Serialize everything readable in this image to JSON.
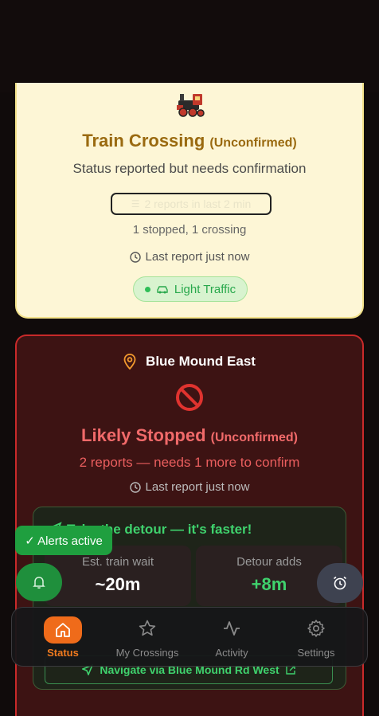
{
  "status_card": {
    "title": "Train Crossing",
    "title_qualifier": "(Unconfirmed)",
    "subtitle": "Status reported but needs confirmation",
    "reports_pill": "2 reports in last 2 min",
    "counts": "1 stopped, 1 crossing",
    "last_report": "Last report just now",
    "traffic_label": "Light Traffic",
    "icon": "locomotive-icon"
  },
  "crossing_card": {
    "location": "Blue Mound East",
    "title": "Likely Stopped",
    "title_qualifier": "(Unconfirmed)",
    "subtitle": "2 reports — needs 1 more to confirm",
    "last_report": "Last report just now",
    "detour": {
      "title": "Take the detour — it's faster!",
      "wait_label": "Est. train wait",
      "wait_value": "~20m",
      "adds_label": "Detour adds",
      "adds_value": "+8m",
      "navigate_label": "Navigate via Blue Mound Rd West"
    }
  },
  "alerts_toast": "✓ Alerts active",
  "bottom_nav": {
    "tabs": [
      {
        "label": "Status",
        "icon": "home-icon",
        "active": true
      },
      {
        "label": "My Crossings",
        "icon": "star-icon",
        "active": false
      },
      {
        "label": "Activity",
        "icon": "activity-icon",
        "active": false
      },
      {
        "label": "Settings",
        "icon": "gear-icon",
        "active": false
      }
    ]
  },
  "colors": {
    "accent": "#ef6b1a",
    "success": "#3fd26d",
    "danger": "#f16a6a",
    "warning_title": "#9a6a10"
  }
}
